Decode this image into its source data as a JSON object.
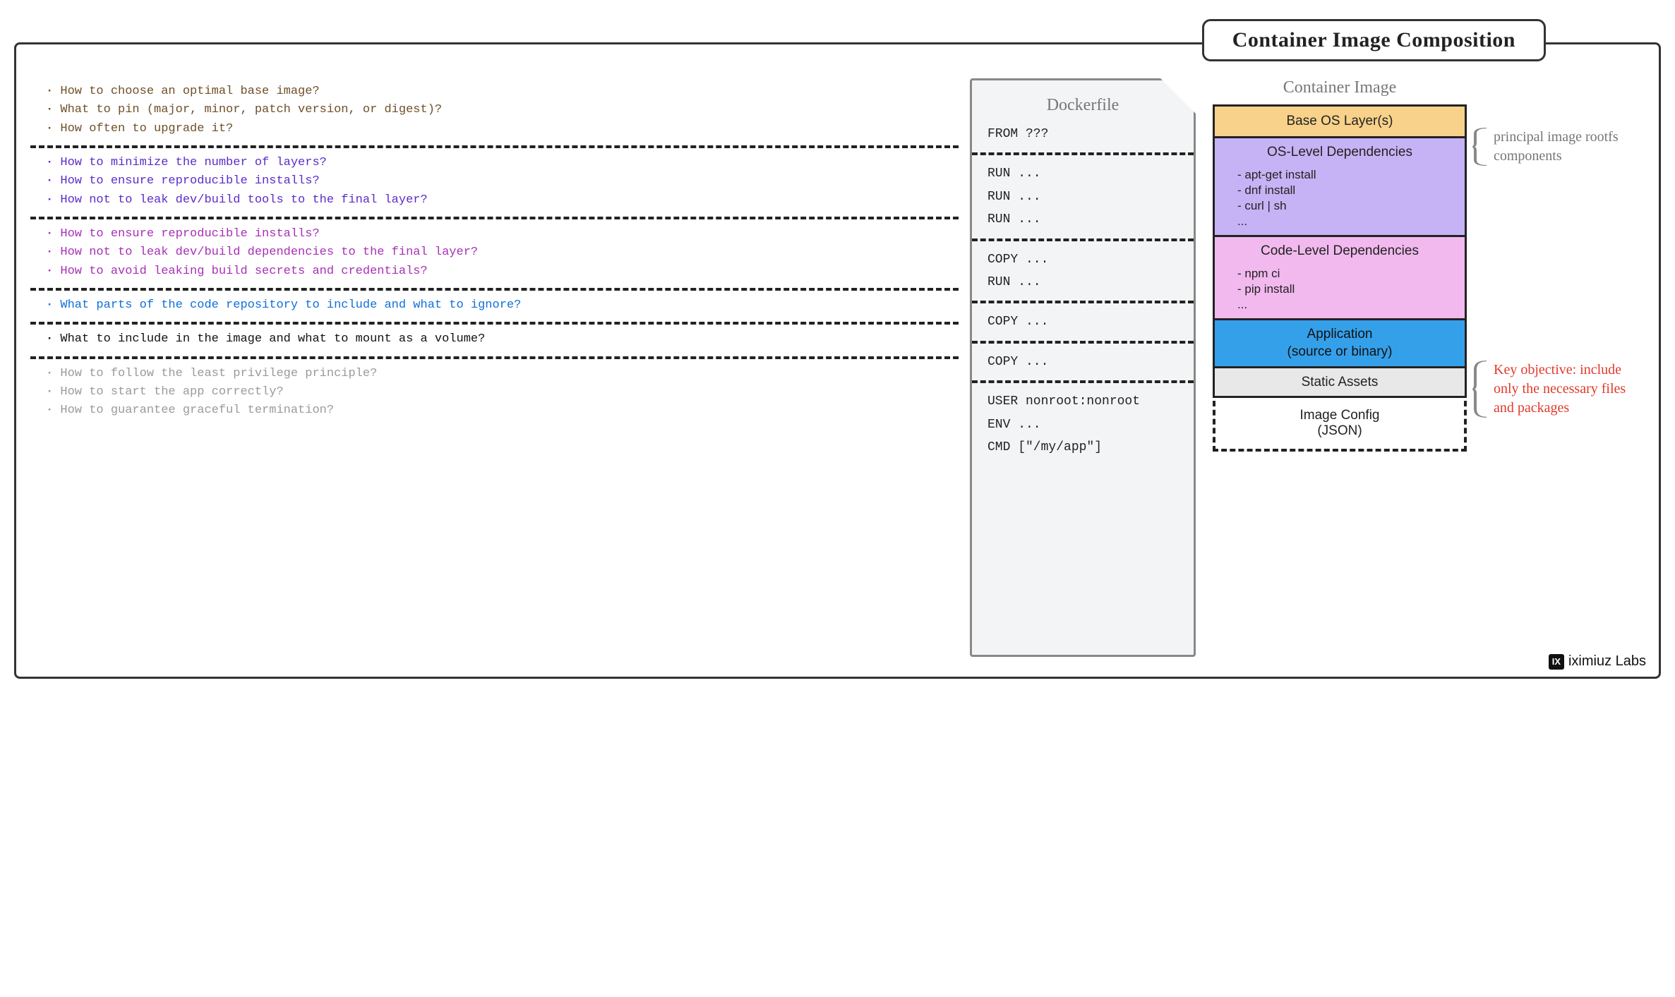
{
  "title": "Container Image Composition",
  "brand": "iximiuz Labs",
  "brand_logo_text": "IX",
  "columns": {
    "dockerfile_heading": "Dockerfile",
    "image_heading": "Container Image"
  },
  "question_groups": [
    {
      "color": "q-brown",
      "items": [
        "How to choose an optimal base image?",
        "What to pin (major, minor, patch version, or digest)?",
        "How often to upgrade it?"
      ]
    },
    {
      "color": "q-violet",
      "items": [
        "How to minimize the number of layers?",
        "How to ensure reproducible installs?",
        "How not to leak dev/build tools to the final layer?"
      ]
    },
    {
      "color": "q-purple",
      "items": [
        "How to ensure reproducible installs?",
        "How not to leak dev/build dependencies to the final layer?",
        "How to avoid leaking build secrets and credentials?"
      ]
    },
    {
      "color": "q-blue",
      "items": [
        "What parts of the code repository to include and what to ignore?"
      ]
    },
    {
      "color": "q-black",
      "items": [
        "What to include in the image and what to mount as a volume?"
      ]
    },
    {
      "color": "q-gray",
      "items": [
        "How to follow the least privilege principle?",
        "How to start the app correctly?",
        "How to guarantee graceful termination?"
      ]
    }
  ],
  "dockerfile_blocks": [
    [
      "FROM ???"
    ],
    [
      "RUN ...",
      "RUN ...",
      "RUN ..."
    ],
    [
      "COPY ...",
      "RUN ..."
    ],
    [
      "COPY ..."
    ],
    [
      "COPY ..."
    ],
    [
      "USER nonroot:nonroot",
      "ENV ...",
      "CMD [\"/my/app\"]"
    ]
  ],
  "image_layers": [
    {
      "class": "base-os",
      "title": "Base OS Layer(s)",
      "sub": []
    },
    {
      "class": "os-dep",
      "title": "OS-Level Dependencies",
      "sub": [
        "- apt-get install",
        "- dnf install",
        "- curl | sh",
        "..."
      ]
    },
    {
      "class": "code-dep",
      "title": "Code-Level Dependencies",
      "sub": [
        "- npm ci",
        "- pip install",
        "..."
      ]
    },
    {
      "class": "app",
      "title": "Application",
      "subtitle": "(source or binary)",
      "sub": []
    },
    {
      "class": "assets",
      "title": "Static Assets",
      "sub": []
    }
  ],
  "image_config": {
    "title": "Image Config",
    "subtitle": "(JSON)"
  },
  "annotations": {
    "top": "principal image rootfs components",
    "mid": "Key objective: include only the necessary files and packages"
  }
}
